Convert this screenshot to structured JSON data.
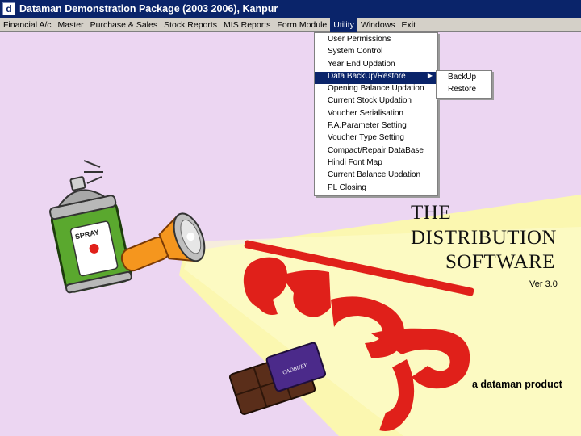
{
  "window": {
    "title": "Dataman Demonstration Package (2003 2006), Kanpur",
    "icon_letter": "d"
  },
  "menubar": {
    "items": [
      "Financial A/c",
      "Master",
      "Purchase & Sales",
      "Stock Reports",
      "MIS Reports",
      "Form Module",
      "Utility",
      "Windows",
      "Exit"
    ],
    "active": "Utility"
  },
  "utility_menu": {
    "items": [
      "User Permissions",
      "System Control",
      "Year End Updation",
      "Data BackUp/Restore",
      "Opening Balance Updation",
      "Current Stock Updation",
      "Voucher Serialisation",
      "F.A.Parameter Setting",
      "Voucher Type Setting",
      "Compact/Repair DataBase",
      "Hindi Font Map",
      "Current Balance Updation",
      "PL Closing"
    ],
    "highlighted": "Data BackUp/Restore"
  },
  "backup_submenu": {
    "items": [
      "BackUp",
      "Restore"
    ]
  },
  "splash": {
    "line1": "THE",
    "line2": "DISTRIBUTION",
    "line3": "SOFTWARE",
    "version": "Ver 3.0",
    "tagline": "a dataman product",
    "spray_label": "SPRAY",
    "chocolate_label": "CADBURY"
  },
  "colors": {
    "background": "#ecd6f2",
    "titlebar": "#0a246a",
    "menubar": "#d4d0c8",
    "highlight": "#0a246a",
    "beam": "#fbf7b0",
    "logo": "#e0201a",
    "can": "#5aa82e",
    "torch": "#f5961e"
  }
}
